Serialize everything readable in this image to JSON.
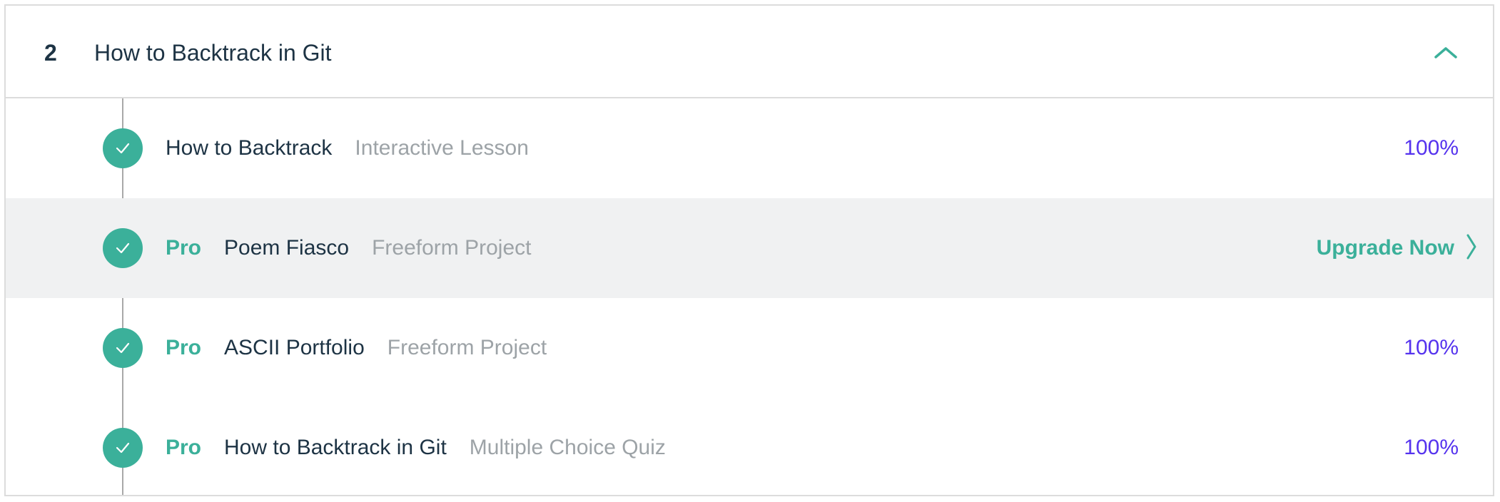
{
  "section": {
    "number": "2",
    "title": "How to Backtrack in Git",
    "toggle_icon": "chevron-up-icon"
  },
  "colors": {
    "accent": "#3bb09a",
    "progress": "#5533ee",
    "text": "#1d3344",
    "muted": "#9da3a7",
    "highlight_row": "#f0f1f2"
  },
  "lessons": [
    {
      "pro": "",
      "title": "How to Backtrack",
      "type": "Interactive Lesson",
      "progress": "100%",
      "completed": true
    },
    {
      "pro": "Pro",
      "title": "Poem Fiasco",
      "type": "Freeform Project",
      "action": "Upgrade Now",
      "action_icon": "chevron-right-icon",
      "completed": true
    },
    {
      "pro": "Pro",
      "title": "ASCII Portfolio",
      "type": "Freeform Project",
      "progress": "100%",
      "completed": true
    },
    {
      "pro": "Pro",
      "title": "How to Backtrack in Git",
      "type": "Multiple Choice Quiz",
      "progress": "100%",
      "completed": true
    }
  ]
}
